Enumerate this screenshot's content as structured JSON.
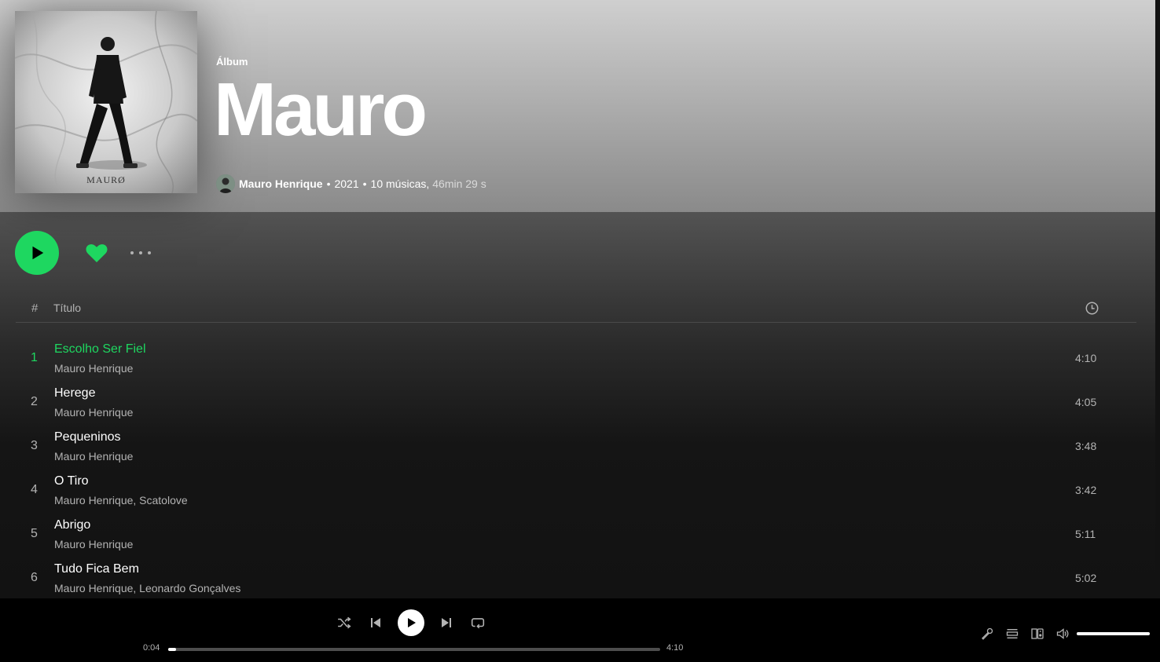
{
  "album": {
    "type_label": "Álbum",
    "title": "Mauro",
    "cover_text": "MAURØ",
    "artist": "Mauro Henrique",
    "separator": "•",
    "year": "2021",
    "song_count": "10 músicas,",
    "total_duration": "46min 29 s"
  },
  "table_header": {
    "hash": "#",
    "title": "Título"
  },
  "tracks": [
    {
      "num": "1",
      "title": "Escolho Ser Fiel",
      "artists": "Mauro Henrique",
      "duration": "4:10"
    },
    {
      "num": "2",
      "title": "Herege",
      "artists": "Mauro Henrique",
      "duration": "4:05"
    },
    {
      "num": "3",
      "title": "Pequeninos",
      "artists": "Mauro Henrique",
      "duration": "3:48"
    },
    {
      "num": "4",
      "title": "O Tiro",
      "artists": "Mauro Henrique, Scatolove",
      "duration": "3:42"
    },
    {
      "num": "5",
      "title": "Abrigo",
      "artists": "Mauro Henrique",
      "duration": "5:11"
    },
    {
      "num": "6",
      "title": "Tudo Fica Bem",
      "artists": "Mauro Henrique, Leonardo Gonçalves",
      "duration": "5:02"
    }
  ],
  "player": {
    "elapsed": "0:04",
    "total": "4:10",
    "progress_fraction": 0.016,
    "volume_fraction": 1.0
  },
  "icons": {
    "play": "play-icon",
    "heart": "heart-icon",
    "more": "more-icon",
    "clock": "clock-icon",
    "shuffle": "shuffle-icon",
    "previous": "previous-icon",
    "next": "next-icon",
    "repeat": "repeat-icon",
    "lyrics": "lyrics-icon",
    "queue": "queue-icon",
    "devices": "devices-icon",
    "volume": "volume-icon"
  },
  "colors": {
    "accent": "#1ed760",
    "background": "#121212",
    "hero": "#a9a9a9",
    "player_bg": "#000000",
    "secondary_text": "#b3b3b3"
  }
}
